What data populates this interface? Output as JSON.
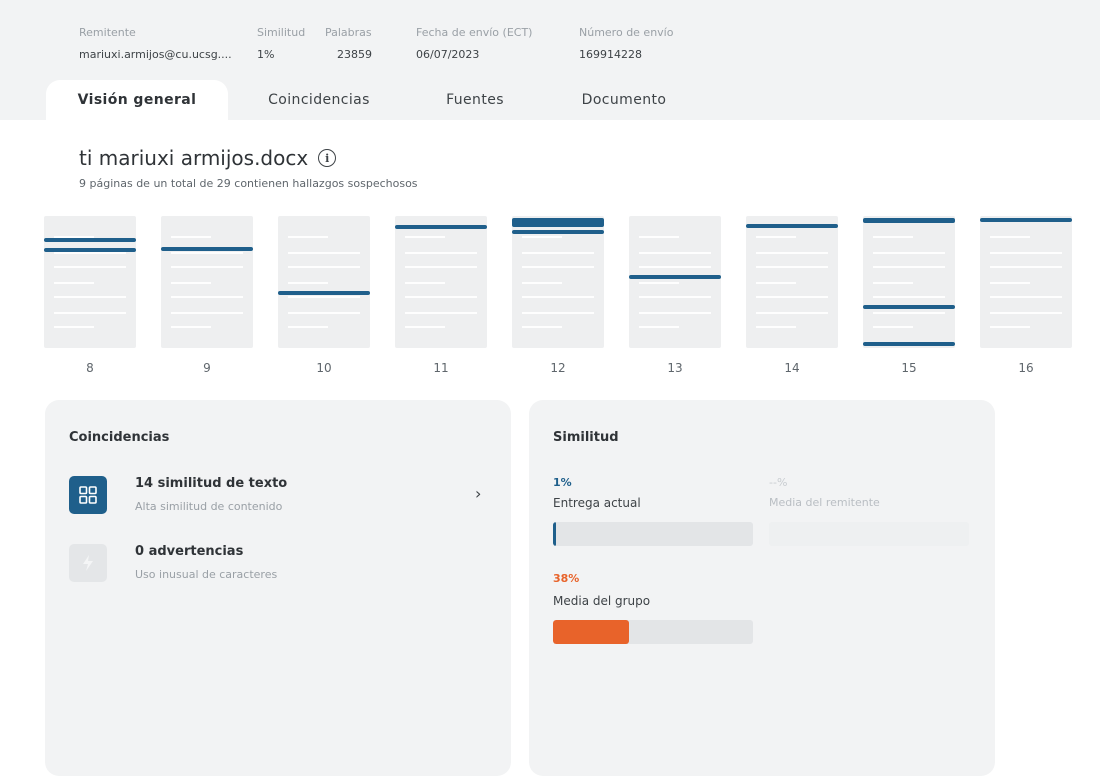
{
  "header": {
    "meta": [
      {
        "label": "Remitente",
        "value": "mariuxi.armijos@cu.ucsg...."
      },
      {
        "label": "Similitud",
        "value": "1%"
      },
      {
        "label": "Palabras",
        "value": "23859"
      },
      {
        "label": "Fecha de envío (ECT)",
        "value": "06/07/2023"
      },
      {
        "label": "Número de envío",
        "value": "169914228"
      }
    ],
    "tabs": [
      {
        "label": "Visión general",
        "active": true
      },
      {
        "label": "Coincidencias",
        "active": false
      },
      {
        "label": "Fuentes",
        "active": false
      },
      {
        "label": "Documento",
        "active": false
      }
    ]
  },
  "document": {
    "title": "ti mariuxi armijos.docx",
    "info_icon": "info-icon",
    "subtitle": "9 páginas de un total de 29 contienen hallazgos sospechosos"
  },
  "pages": [
    {
      "number": "8"
    },
    {
      "number": "9"
    },
    {
      "number": "10"
    },
    {
      "number": "11"
    },
    {
      "number": "12"
    },
    {
      "number": "13"
    },
    {
      "number": "14"
    },
    {
      "number": "15"
    },
    {
      "number": "16"
    }
  ],
  "matches_card": {
    "title": "Coincidencias",
    "items": [
      {
        "title": "14 similitud de texto",
        "subtitle": "Alta similitud de contenido",
        "icon": "grid-icon",
        "chevron": "›"
      },
      {
        "title": "0 advertencias",
        "subtitle": "Uso inusual de caracteres",
        "icon": "lightning-icon"
      }
    ]
  },
  "similarity_card": {
    "title": "Similitud",
    "current": {
      "percent": "1%",
      "label": "Entrega actual",
      "value": 0.01
    },
    "sender_avg": {
      "percent": "--%",
      "label": "Media del remitente"
    },
    "group_avg": {
      "percent": "38%",
      "label": "Media del grupo",
      "value": 0.38
    }
  },
  "colors": {
    "accent_blue": "#1f5f8b",
    "accent_orange": "#e8632a",
    "card_bg": "#f2f3f4"
  }
}
